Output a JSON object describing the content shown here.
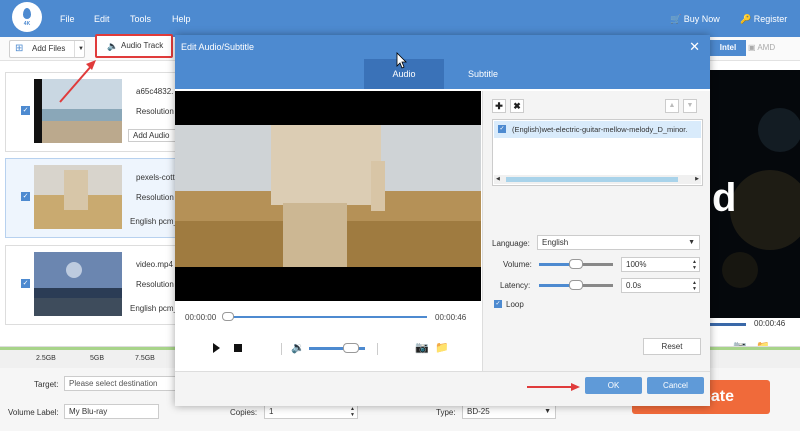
{
  "app": {
    "logo_text": "4K",
    "menu": [
      "File",
      "Edit",
      "Tools",
      "Help"
    ],
    "buy_now": "Buy Now",
    "register": "Register"
  },
  "toolbar": {
    "add_files": "Add Files",
    "audio_track": "Audio Track",
    "intel": "Intel",
    "amd": "AMD"
  },
  "files": [
    {
      "name": "a65c4832.",
      "resolution": "Resolution",
      "audio": "Add Audio"
    },
    {
      "name": "pexels-cott",
      "resolution": "Resolution",
      "audio": "English pcm_"
    },
    {
      "name": "video.mp4",
      "resolution": "Resolution",
      "audio": "English pcm_"
    }
  ],
  "preview": {
    "letter": "d",
    "time": "00:00:46"
  },
  "disk": {
    "labels": [
      "2.5GB",
      "5GB",
      "7.5GB"
    ]
  },
  "form": {
    "target_label": "Target:",
    "target_placeholder": "Please select destination",
    "volume_label": "Volume Label:",
    "volume_value": "My Blu-ray",
    "copies_label": "Copies:",
    "copies_value": "1",
    "type_label": "Type:",
    "type_value": "BD-25",
    "create": "eate"
  },
  "modal": {
    "title": "Edit Audio/Subtitle",
    "tabs": [
      "Audio",
      "Subtitle"
    ],
    "active_tab": "Audio",
    "time_start": "00:00:00",
    "time_end": "00:00:46",
    "volume_level": 0.75,
    "tracks": [
      {
        "name": "(English)wet-electric-guitar-mellow-melody_D_minor.",
        "checked": true
      }
    ],
    "language_label": "Language:",
    "language_value": "English",
    "volume_label": "Volume:",
    "volume_value": "100%",
    "volume_slider": 0.5,
    "latency_label": "Latency:",
    "latency_value": "0.0s",
    "latency_slider": 0.5,
    "loop_label": "Loop",
    "reset": "Reset",
    "ok": "OK",
    "cancel": "Cancel"
  },
  "colors": {
    "primary": "#4d8ad0",
    "accent": "#f06a3a",
    "highlight": "#e03b3b"
  }
}
